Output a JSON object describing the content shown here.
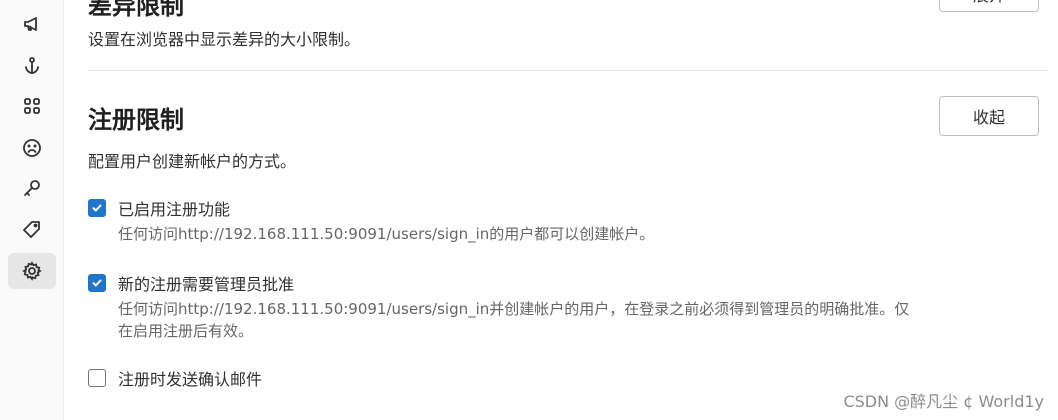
{
  "sidebar": {
    "items": [
      {
        "icon": "megaphone-icon"
      },
      {
        "icon": "anchor-icon"
      },
      {
        "icon": "grid-icon"
      },
      {
        "icon": "sad-face-icon"
      },
      {
        "icon": "key-icon"
      },
      {
        "icon": "tag-icon"
      },
      {
        "icon": "gear-icon",
        "active": true
      }
    ]
  },
  "diff_section": {
    "title": "差异限制",
    "button_label": "展开",
    "description": "设置在浏览器中显示差异的大小限制。"
  },
  "signup_section": {
    "title": "注册限制",
    "collapse_label": "收起",
    "description": "配置用户创建新帐户的方式。",
    "settings": [
      {
        "label": "已启用注册功能",
        "help": "任何访问http://192.168.111.50:9091/users/sign_in的用户都可以创建帐户。",
        "checked": true
      },
      {
        "label": "新的注册需要管理员批准",
        "help": "任何访问http://192.168.111.50:9091/users/sign_in并创建帐户的用户，在登录之前必须得到管理员的明确批准。仅在启用注册后有效。",
        "checked": true
      },
      {
        "label": "注册时发送确认邮件",
        "checked": false
      }
    ]
  },
  "watermark": "CSDN @醉凡尘 ¢ World1y",
  "colors": {
    "checkbox_checked": "#1f75cb",
    "active_nav_bg": "#e6e6e6"
  }
}
